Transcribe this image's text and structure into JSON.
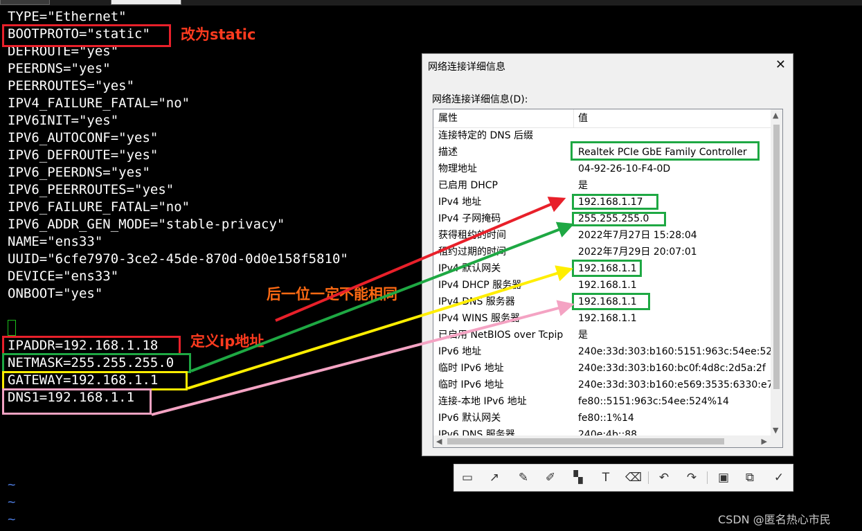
{
  "terminal": {
    "lines": [
      "TYPE=\"Ethernet\"",
      "BOOTPROTO=\"static\"",
      "DEFROUTE=\"yes\"",
      "PEERDNS=\"yes\"",
      "PEERROUTES=\"yes\"",
      "IPV4_FAILURE_FATAL=\"no\"",
      "IPV6INIT=\"yes\"",
      "IPV6_AUTOCONF=\"yes\"",
      "IPV6_DEFROUTE=\"yes\"",
      "IPV6_PEERDNS=\"yes\"",
      "IPV6_PEERROUTES=\"yes\"",
      "IPV6_FAILURE_FATAL=\"no\"",
      "IPV6_ADDR_GEN_MODE=\"stable-privacy\"",
      "NAME=\"ens33\"",
      "UUID=\"6cfe7970-3ce2-45de-870d-0d0e158f5810\"",
      "DEVICE=\"ens33\"",
      "ONBOOT=\"yes\"",
      "",
      "",
      "IPADDR=192.168.1.18",
      "NETMASK=255.255.255.0",
      "GATEWAY=192.168.1.1",
      "DNS1=192.168.1.1"
    ],
    "tildes": [
      "~",
      "~",
      "~"
    ]
  },
  "annotations": {
    "static_note": "改为static",
    "ip_note": "定义ip地址",
    "unique_note": "后一位一定不能相同"
  },
  "dialog": {
    "title": "网络连接详细信息",
    "close_glyph": "✕",
    "list_label": "网络连接详细信息(D):",
    "col_property": "属性",
    "col_value": "值",
    "rows": [
      {
        "k": "连接特定的 DNS 后缀",
        "v": ""
      },
      {
        "k": "描述",
        "v": "Realtek PCIe GbE Family Controller"
      },
      {
        "k": "物理地址",
        "v": "04-92-26-10-F4-0D"
      },
      {
        "k": "已启用 DHCP",
        "v": "是"
      },
      {
        "k": "IPv4 地址",
        "v": "192.168.1.17"
      },
      {
        "k": "IPv4 子网掩码",
        "v": "255.255.255.0"
      },
      {
        "k": "获得租约的时间",
        "v": "2022年7月27日 15:28:04"
      },
      {
        "k": "租约过期的时间",
        "v": "2022年7月29日 20:07:01"
      },
      {
        "k": "IPv4 默认网关",
        "v": "192.168.1.1"
      },
      {
        "k": "IPv4 DHCP 服务器",
        "v": "192.168.1.1"
      },
      {
        "k": "IPv4 DNS 服务器",
        "v": "192.168.1.1"
      },
      {
        "k": "IPv4 WINS 服务器",
        "v": "192.168.1.1"
      },
      {
        "k": "已启用 NetBIOS over Tcpip",
        "v": "是"
      },
      {
        "k": "IPv6 地址",
        "v": "240e:33d:303:b160:5151:963c:54ee:52"
      },
      {
        "k": "临时 IPv6 地址",
        "v": "240e:33d:303:b160:bc0f:4d8c:2d5a:2f"
      },
      {
        "k": "临时 IPv6 地址",
        "v": "240e:33d:303:b160:e569:3535:6330:e7"
      },
      {
        "k": "连接-本地 IPv6 地址",
        "v": "fe80::5151:963c:54ee:524%14"
      },
      {
        "k": "IPv6 默认网关",
        "v": "fe80::1%14"
      },
      {
        "k": "IPv6 DNS 服务器",
        "v": "240e:4b::88"
      }
    ]
  },
  "toolbar": {
    "icons": [
      "rectangle-icon",
      "line-arrow-icon",
      "pen-icon",
      "marker-icon",
      "mosaic-icon",
      "text-icon",
      "eraser-icon",
      "undo-icon",
      "redo-icon",
      "save-icon",
      "copy-icon",
      "confirm-icon"
    ]
  },
  "watermark": "CSDN @匿名热心市民",
  "colors": {
    "red": "#e8202a",
    "green": "#1ea843",
    "yellow": "#ffee00",
    "pink": "#f4a3c3",
    "tilde": "#4a78d9"
  }
}
